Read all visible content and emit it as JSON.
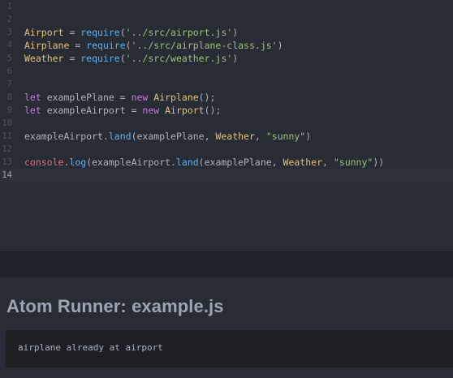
{
  "editor": {
    "current_line": "14",
    "lines": [
      {
        "num": "1",
        "tokens": []
      },
      {
        "num": "2",
        "tokens": []
      },
      {
        "num": "3",
        "tokens": [
          {
            "t": "Airport",
            "c": "var"
          },
          {
            "t": " = ",
            "c": "plain"
          },
          {
            "t": "require",
            "c": "fn"
          },
          {
            "t": "(",
            "c": "plain"
          },
          {
            "t": "'../src/airport.js'",
            "c": "str"
          },
          {
            "t": ")",
            "c": "plain"
          }
        ]
      },
      {
        "num": "4",
        "tokens": [
          {
            "t": "Airplane",
            "c": "var"
          },
          {
            "t": " = ",
            "c": "plain"
          },
          {
            "t": "require",
            "c": "fn"
          },
          {
            "t": "(",
            "c": "plain"
          },
          {
            "t": "'../src/airplane-class.js'",
            "c": "str"
          },
          {
            "t": ")",
            "c": "plain"
          }
        ]
      },
      {
        "num": "5",
        "tokens": [
          {
            "t": "Weather",
            "c": "var"
          },
          {
            "t": " = ",
            "c": "plain"
          },
          {
            "t": "require",
            "c": "fn"
          },
          {
            "t": "(",
            "c": "plain"
          },
          {
            "t": "'../src/weather.js'",
            "c": "str"
          },
          {
            "t": ")",
            "c": "plain"
          }
        ]
      },
      {
        "num": "6",
        "tokens": []
      },
      {
        "num": "7",
        "tokens": []
      },
      {
        "num": "8",
        "tokens": [
          {
            "t": "let",
            "c": "kw"
          },
          {
            "t": " examplePlane = ",
            "c": "plain"
          },
          {
            "t": "new",
            "c": "kw"
          },
          {
            "t": " ",
            "c": "plain"
          },
          {
            "t": "Airplane",
            "c": "var"
          },
          {
            "t": "();",
            "c": "plain"
          }
        ]
      },
      {
        "num": "9",
        "tokens": [
          {
            "t": "let",
            "c": "kw"
          },
          {
            "t": " exampleAirport = ",
            "c": "plain"
          },
          {
            "t": "new",
            "c": "kw"
          },
          {
            "t": " ",
            "c": "plain"
          },
          {
            "t": "Airport",
            "c": "var"
          },
          {
            "t": "();",
            "c": "plain"
          }
        ]
      },
      {
        "num": "10",
        "tokens": []
      },
      {
        "num": "11",
        "tokens": [
          {
            "t": "exampleAirport.",
            "c": "plain"
          },
          {
            "t": "land",
            "c": "fn"
          },
          {
            "t": "(examplePlane, ",
            "c": "plain"
          },
          {
            "t": "Weather",
            "c": "var"
          },
          {
            "t": ", ",
            "c": "plain"
          },
          {
            "t": "\"sunny\"",
            "c": "str"
          },
          {
            "t": ")",
            "c": "plain"
          }
        ]
      },
      {
        "num": "12",
        "tokens": []
      },
      {
        "num": "13",
        "tokens": [
          {
            "t": "console",
            "c": "red"
          },
          {
            "t": ".",
            "c": "plain"
          },
          {
            "t": "log",
            "c": "fn"
          },
          {
            "t": "(exampleAirport.",
            "c": "plain"
          },
          {
            "t": "land",
            "c": "fn"
          },
          {
            "t": "(examplePlane, ",
            "c": "plain"
          },
          {
            "t": "Weather",
            "c": "var"
          },
          {
            "t": ", ",
            "c": "plain"
          },
          {
            "t": "\"sunny\"",
            "c": "str"
          },
          {
            "t": "))",
            "c": "plain"
          }
        ]
      },
      {
        "num": "14",
        "tokens": []
      }
    ]
  },
  "runner": {
    "title": "Atom Runner: example.js",
    "output": "airplane already at airport"
  },
  "colors": {
    "background": "#282c34",
    "keyword": "#c678dd",
    "variable": "#e5c07b",
    "function": "#61afef",
    "string": "#98c379",
    "console": "#e06c75",
    "plain": "#abb2bf"
  }
}
